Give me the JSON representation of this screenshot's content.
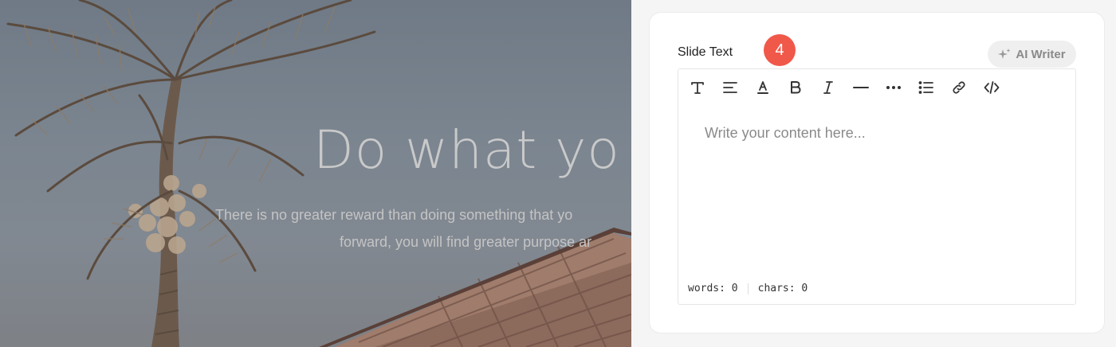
{
  "preview": {
    "title": "Do what yo",
    "subtitle_line1": "There is no greater reward than doing something that yo",
    "subtitle_line2": "forward, you will find greater purpose ar"
  },
  "panel": {
    "field_label": "Slide Text",
    "step_badge": "4",
    "ai_writer_label": "AI Writer",
    "toolbar": [
      {
        "name": "text-style",
        "icon": "text-style-icon"
      },
      {
        "name": "align",
        "icon": "align-left-icon"
      },
      {
        "name": "text-color",
        "icon": "text-color-icon"
      },
      {
        "name": "bold",
        "icon": "bold-icon"
      },
      {
        "name": "italic",
        "icon": "italic-icon"
      },
      {
        "name": "horizontal-rule",
        "icon": "horizontal-rule-icon"
      },
      {
        "name": "more",
        "icon": "more-dots-icon"
      },
      {
        "name": "list",
        "icon": "list-icon"
      },
      {
        "name": "link",
        "icon": "link-icon"
      },
      {
        "name": "code",
        "icon": "code-icon"
      }
    ],
    "editor": {
      "placeholder": "Write your content here...",
      "words_label": "words: 0",
      "chars_label": "chars: 0"
    }
  },
  "colors": {
    "badge": "#f0584a",
    "panel_bg": "#ffffff",
    "page_bg": "#f5f5f5"
  }
}
